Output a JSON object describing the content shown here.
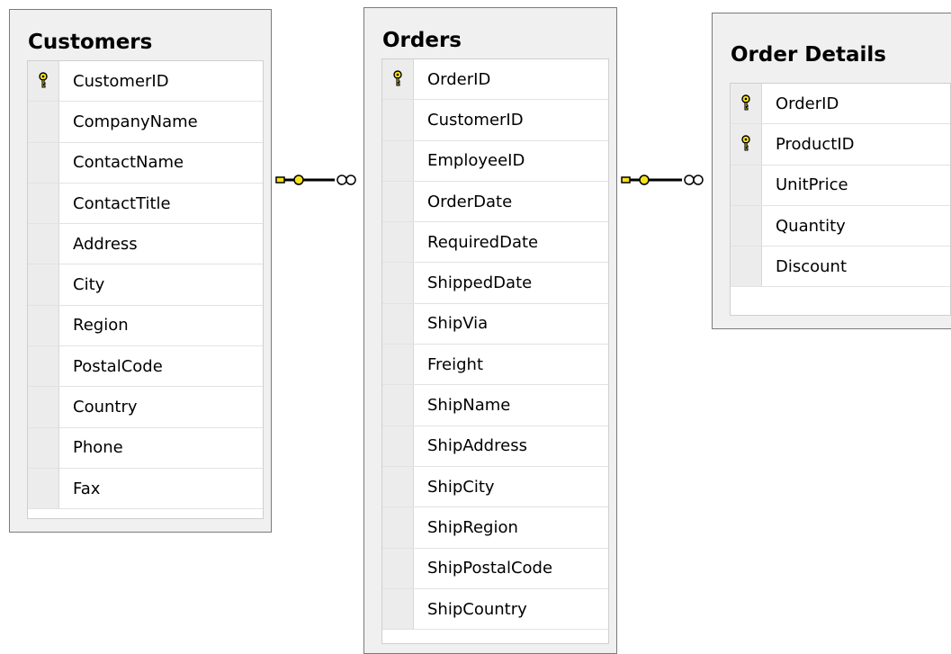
{
  "tables": [
    {
      "name": "Customers",
      "selected": true,
      "columns": [
        {
          "name": "CustomerID",
          "key": true
        },
        {
          "name": "CompanyName",
          "key": false
        },
        {
          "name": "ContactName",
          "key": false
        },
        {
          "name": "ContactTitle",
          "key": false
        },
        {
          "name": "Address",
          "key": false
        },
        {
          "name": "City",
          "key": false
        },
        {
          "name": "Region",
          "key": false
        },
        {
          "name": "PostalCode",
          "key": false
        },
        {
          "name": "Country",
          "key": false
        },
        {
          "name": "Phone",
          "key": false
        },
        {
          "name": "Fax",
          "key": false
        }
      ]
    },
    {
      "name": "Orders",
      "selected": false,
      "columns": [
        {
          "name": "OrderID",
          "key": true
        },
        {
          "name": "CustomerID",
          "key": false
        },
        {
          "name": "EmployeeID",
          "key": false
        },
        {
          "name": "OrderDate",
          "key": false
        },
        {
          "name": "RequiredDate",
          "key": false
        },
        {
          "name": "ShippedDate",
          "key": false
        },
        {
          "name": "ShipVia",
          "key": false
        },
        {
          "name": "Freight",
          "key": false
        },
        {
          "name": "ShipName",
          "key": false
        },
        {
          "name": "ShipAddress",
          "key": false
        },
        {
          "name": "ShipCity",
          "key": false
        },
        {
          "name": "ShipRegion",
          "key": false
        },
        {
          "name": "ShipPostalCode",
          "key": false
        },
        {
          "name": "ShipCountry",
          "key": false
        }
      ]
    },
    {
      "name": "Order Details",
      "selected": false,
      "columns": [
        {
          "name": "OrderID",
          "key": true
        },
        {
          "name": "ProductID",
          "key": true
        },
        {
          "name": "UnitPrice",
          "key": false
        },
        {
          "name": "Quantity",
          "key": false
        },
        {
          "name": "Discount",
          "key": false
        }
      ]
    }
  ],
  "relationships": [
    {
      "from": "Customers",
      "to": "Orders",
      "from_end": "key",
      "to_end": "infinity"
    },
    {
      "from": "Orders",
      "to": "Order Details",
      "from_end": "key",
      "to_end": "infinity"
    }
  ],
  "colors": {
    "selection": "#3399ff",
    "connector": "#000000",
    "key": "#f5e21a"
  }
}
